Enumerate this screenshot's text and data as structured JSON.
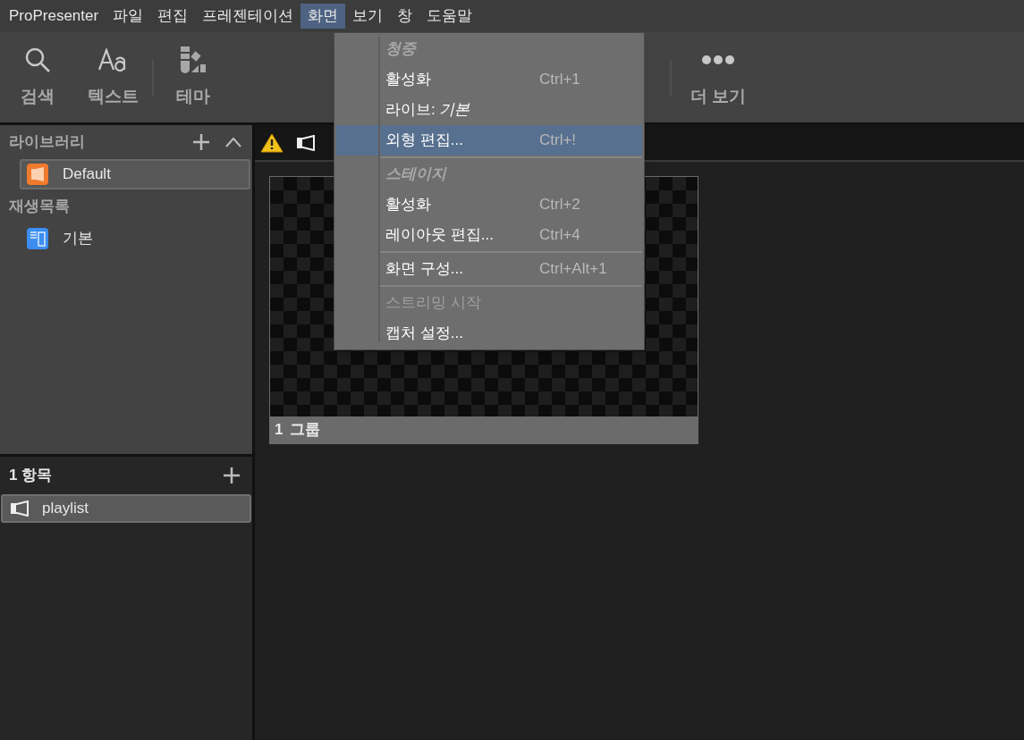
{
  "menubar": [
    {
      "label": "ProPresenter",
      "selected": false
    },
    {
      "label": "파일",
      "selected": false
    },
    {
      "label": "편집",
      "selected": false
    },
    {
      "label": "프레젠테이션",
      "selected": false
    },
    {
      "label": "화면",
      "selected": true
    },
    {
      "label": "보기",
      "selected": false
    },
    {
      "label": "창",
      "selected": false
    },
    {
      "label": "도움말",
      "selected": false
    }
  ],
  "toolbar": [
    {
      "kind": "search",
      "label": "검색"
    },
    {
      "kind": "text",
      "label": "텍스트"
    },
    {
      "kind": "theme",
      "label": "테마"
    },
    {
      "kind": "more",
      "label": "더 보기"
    }
  ],
  "library": {
    "title": "라이브러리",
    "items": [
      {
        "label": "Default",
        "selected": true
      }
    ]
  },
  "playlists": {
    "title": "재생목록",
    "items": [
      {
        "label": "기본",
        "selected": false
      }
    ]
  },
  "items_panel": {
    "title": "1 항목",
    "items": [
      {
        "label": "playlist",
        "selected": true
      }
    ]
  },
  "slide": {
    "number": "1",
    "label": "그룹"
  },
  "menu": [
    {
      "kind": "header",
      "label": "청중"
    },
    {
      "kind": "item",
      "label": "활성화",
      "shortcut": "Ctrl+1",
      "selected": false,
      "disabled": false
    },
    {
      "kind": "item",
      "label": "라이브: *기본*",
      "selected": false,
      "disabled": false
    },
    {
      "kind": "item",
      "label": "외형 편집...",
      "shortcut": "Ctrl+!",
      "selected": true,
      "disabled": false
    },
    {
      "kind": "separator"
    },
    {
      "kind": "header",
      "label": "스테이지"
    },
    {
      "kind": "item",
      "label": "활성화",
      "shortcut": "Ctrl+2",
      "selected": false,
      "disabled": false
    },
    {
      "kind": "item",
      "label": "레이아웃 편집...",
      "shortcut": "Ctrl+4",
      "selected": false,
      "disabled": false
    },
    {
      "kind": "separator"
    },
    {
      "kind": "item",
      "label": "화면 구성...",
      "shortcut": "Ctrl+Alt+1",
      "selected": false,
      "disabled": false
    },
    {
      "kind": "separator"
    },
    {
      "kind": "item",
      "label": "스트리밍 시작",
      "selected": false,
      "disabled": true
    },
    {
      "kind": "item",
      "label": "캡처 설정...",
      "selected": false,
      "disabled": false
    }
  ]
}
